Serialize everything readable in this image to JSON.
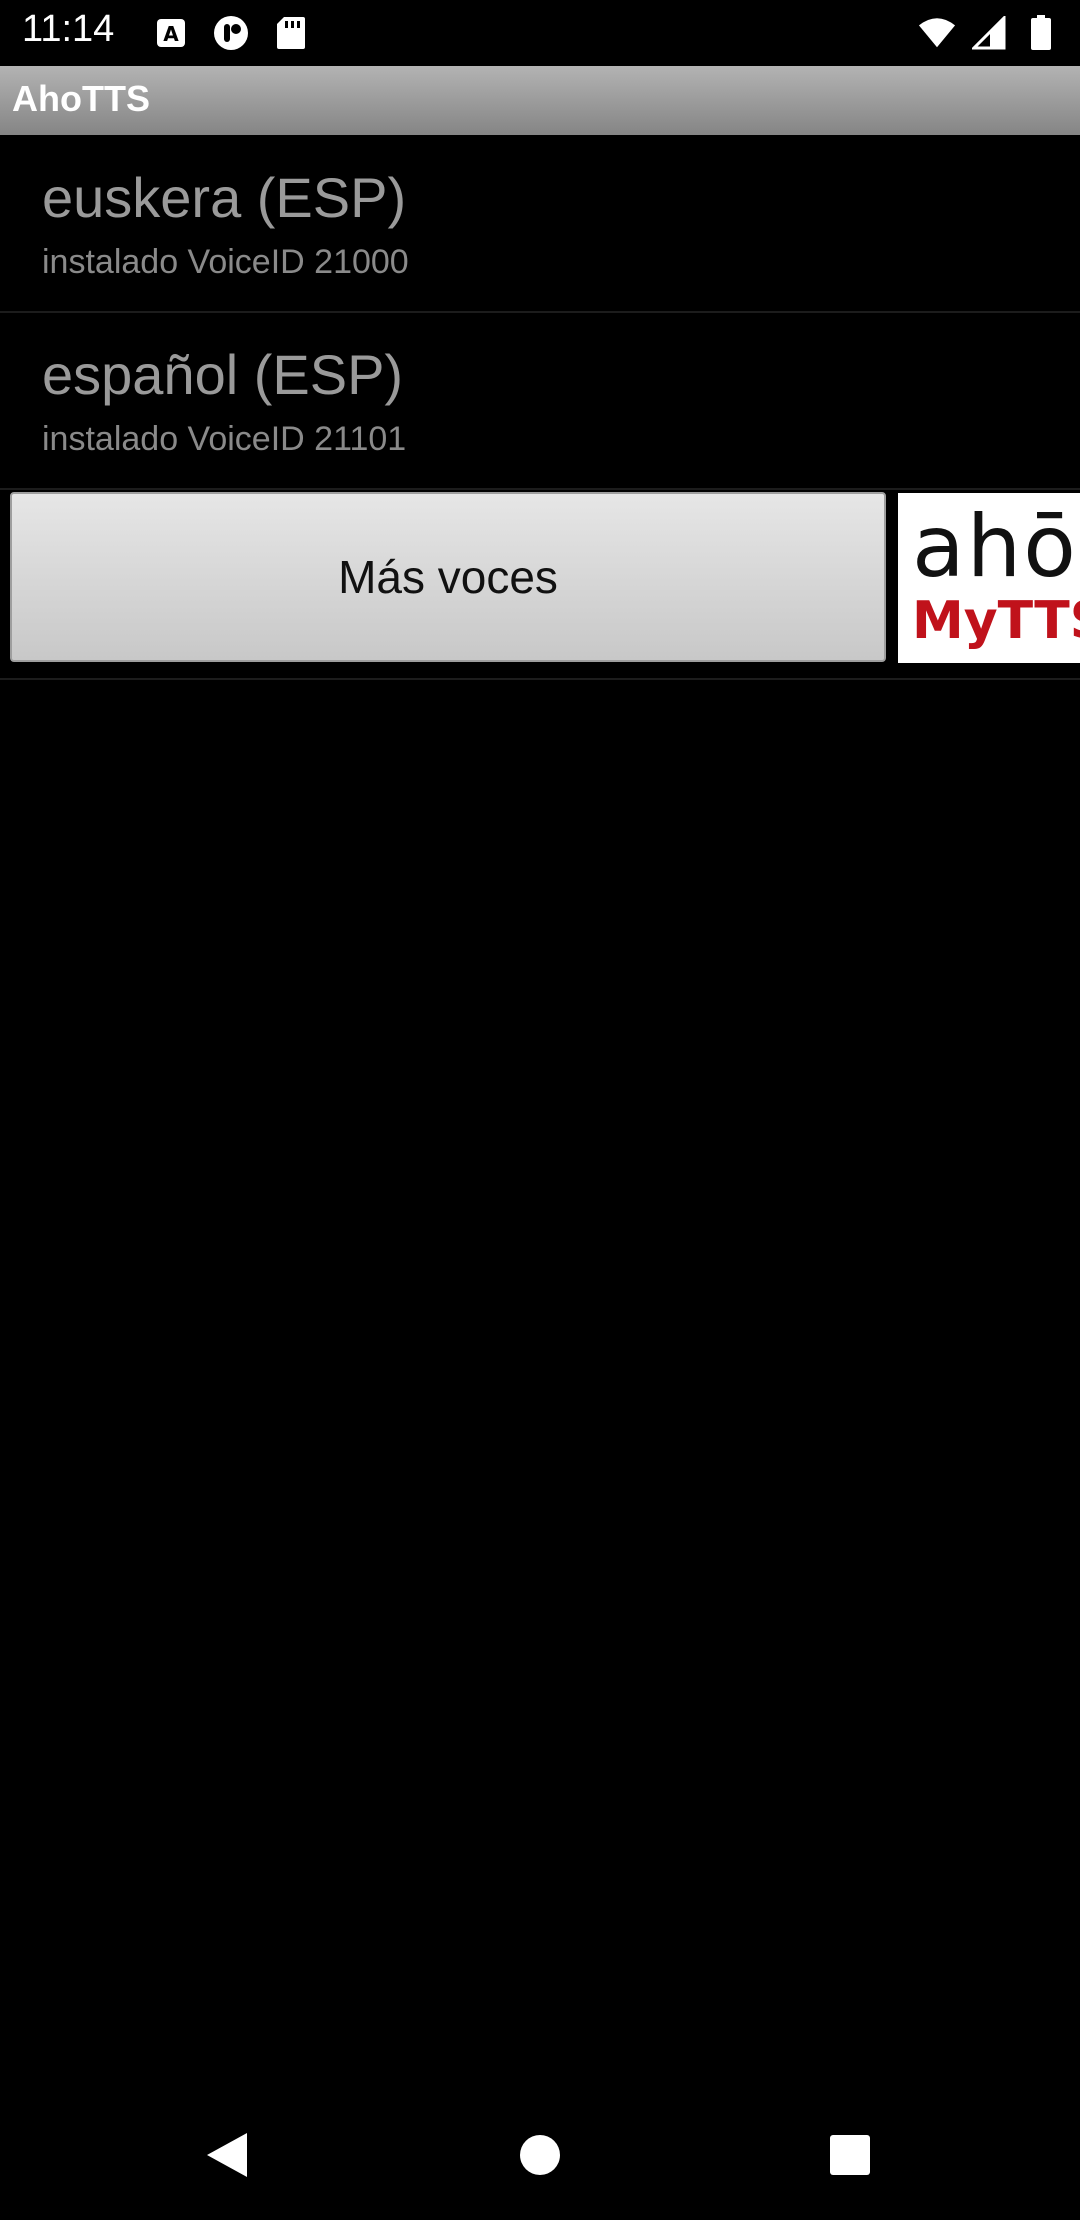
{
  "status_bar": {
    "time": "11:14",
    "left_icons": [
      "font-icon",
      "app-notification-icon",
      "sd-card-icon"
    ],
    "right_icons": [
      "wifi-icon",
      "signal-icon",
      "battery-icon"
    ]
  },
  "app": {
    "title": "AhoTTS"
  },
  "voices": [
    {
      "name": "euskera (ESP)",
      "status": "instalado VoiceID 21000"
    },
    {
      "name": "español (ESP)",
      "status": "instalado VoiceID 21101"
    }
  ],
  "more_voices_label": "Más voces",
  "logo": {
    "top_text": "ahō",
    "bottom_text": "MyTTS",
    "accent_color": "#c0121b"
  },
  "nav_bar": {
    "icons": [
      "back-icon",
      "home-icon",
      "recents-icon"
    ]
  }
}
